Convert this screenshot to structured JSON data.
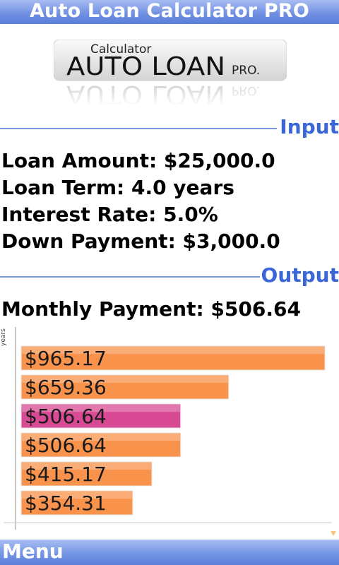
{
  "app": {
    "title": "Auto Loan Calculator PRO"
  },
  "logo": {
    "small": "Calculator",
    "main": "AUTO LOAN",
    "suffix": "PRO."
  },
  "input": {
    "heading": "Input",
    "loan_amount": "Loan Amount: $25,000.0",
    "loan_term": "Loan Term: 4.0 years",
    "interest_rate": "Interest Rate: 5.0%",
    "down_payment": "Down Payment: $3,000.0"
  },
  "output": {
    "heading": "Output",
    "monthly_payment": "Monthly Payment: $506.64"
  },
  "chart_data": {
    "type": "bar",
    "orientation": "horizontal",
    "ylabel": "years",
    "values": [
      965.17,
      659.36,
      506.64,
      506.64,
      415.17,
      354.31
    ],
    "labels": [
      "$965.17",
      "$659.36",
      "$506.64",
      "$506.64",
      "$415.17",
      "$354.31"
    ],
    "highlight_index": 2,
    "bar_color": "#f9924a",
    "highlight_color": "#d84a93"
  },
  "menu": {
    "label": "Menu"
  }
}
